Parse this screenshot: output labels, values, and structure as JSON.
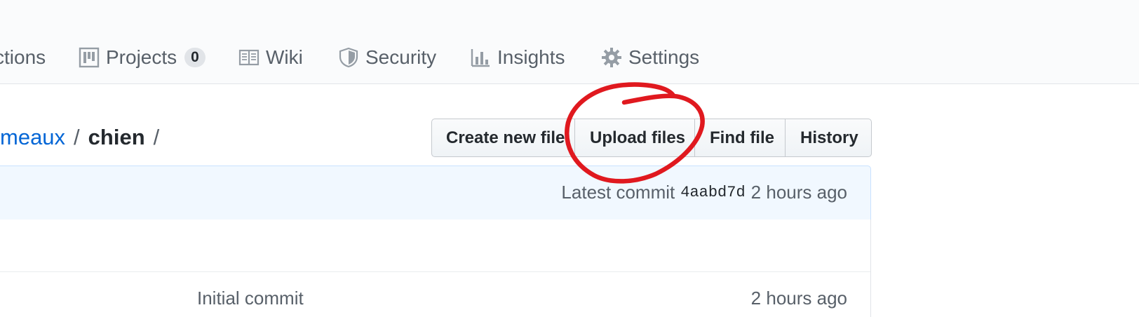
{
  "nav": {
    "items": [
      {
        "label": "ctions",
        "icon": "actions-icon"
      },
      {
        "label": "Projects",
        "icon": "project-board-icon",
        "count": "0"
      },
      {
        "label": "Wiki",
        "icon": "book-icon"
      },
      {
        "label": "Security",
        "icon": "shield-icon"
      },
      {
        "label": "Insights",
        "icon": "graph-icon"
      },
      {
        "label": "Settings",
        "icon": "gear-icon"
      }
    ]
  },
  "breadcrumb": {
    "parent": "meaux",
    "separator": "/",
    "current": "chien"
  },
  "toolbar": {
    "create_new_file": "Create new file",
    "upload_files": "Upload files",
    "find_file": "Find file",
    "history": "History"
  },
  "commit_bar": {
    "prefix": "Latest commit",
    "sha": "4aabd7d",
    "age": "2 hours ago"
  },
  "files": [
    {
      "message": "",
      "age": ""
    },
    {
      "message": "Initial commit",
      "age": "2 hours ago"
    }
  ],
  "colors": {
    "link": "#0366d6",
    "annotation": "#e0191f",
    "commit_bg": "#f1f8ff"
  }
}
